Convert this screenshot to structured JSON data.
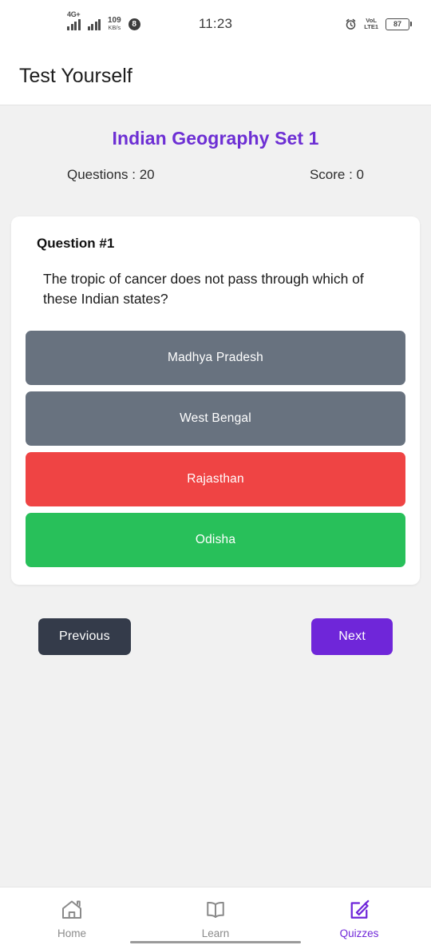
{
  "status_bar": {
    "network_type": "4G+",
    "data_speed_value": "109",
    "data_speed_unit": "KB/s",
    "notification_count": "8",
    "time": "11:23",
    "volte_line1": "VoL",
    "volte_line2": "LTE1",
    "battery_percent": "87",
    "alarm_icon": "alarm-clock-icon"
  },
  "appbar": {
    "title": "Test Yourself"
  },
  "quiz": {
    "title": "Indian Geography Set 1",
    "questions_label": "Questions : 20",
    "score_label": "Score : 0",
    "accent_color": "#6d2fd4",
    "question_number": "Question #1",
    "question_text": "The tropic of cancer does not pass through which of these Indian states?",
    "options": [
      {
        "label": "Madhya Pradesh",
        "state": "neutral",
        "color": "#68727f"
      },
      {
        "label": "West Bengal",
        "state": "neutral",
        "color": "#68727f"
      },
      {
        "label": "Rajasthan",
        "state": "wrong",
        "color": "#ef4444"
      },
      {
        "label": "Odisha",
        "state": "correct",
        "color": "#28c05a"
      }
    ],
    "previous_label": "Previous",
    "next_label": "Next",
    "previous_color": "#343b4a",
    "next_color": "#6f26d9"
  },
  "bottom_nav": {
    "items": [
      {
        "label": "Home",
        "icon": "home-icon",
        "active": false
      },
      {
        "label": "Learn",
        "icon": "book-icon",
        "active": false
      },
      {
        "label": "Quizzes",
        "icon": "edit-square-icon",
        "active": true
      }
    ]
  }
}
